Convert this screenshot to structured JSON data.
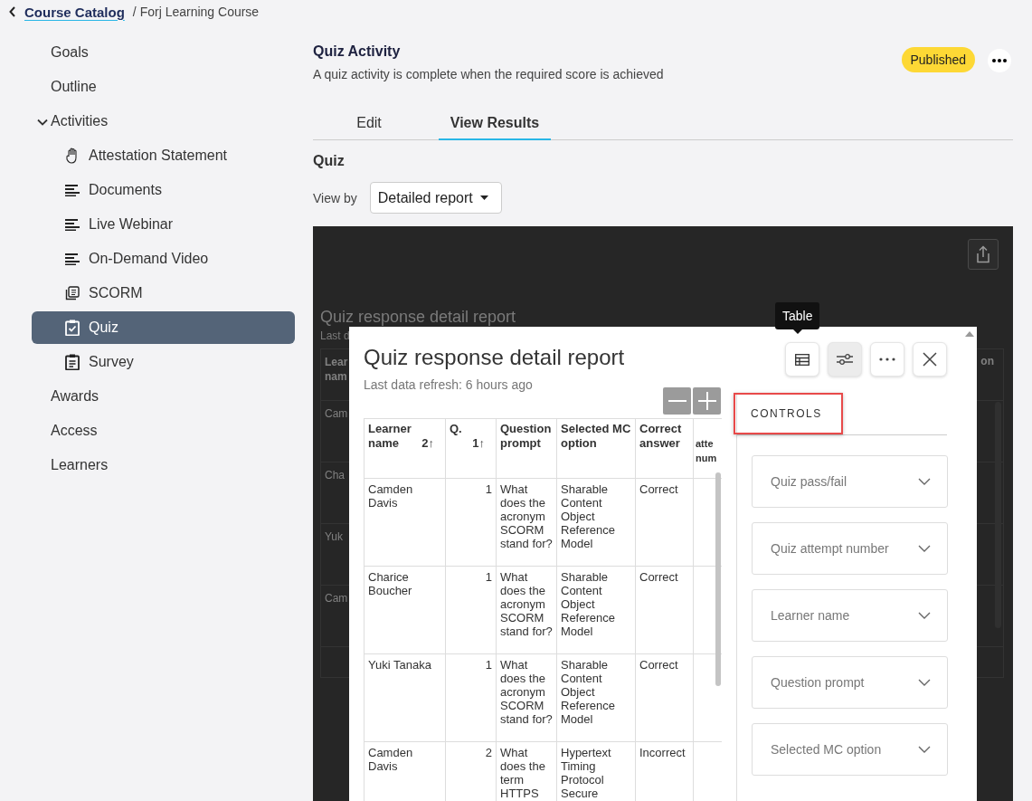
{
  "breadcrumb": {
    "link": "Course Catalog",
    "current": "/ Forj Learning Course"
  },
  "sidebar": {
    "items": [
      {
        "label": "Goals",
        "selected": false
      },
      {
        "label": "Outline",
        "selected": false
      },
      {
        "label": "Activities",
        "selected": false,
        "expanded": true,
        "children": [
          {
            "label": "Attestation Statement",
            "kind": "hand",
            "selected": false
          },
          {
            "label": "Documents",
            "kind": "lines",
            "selected": false
          },
          {
            "label": "Live Webinar",
            "kind": "lines",
            "selected": false
          },
          {
            "label": "On-Demand Video",
            "kind": "lines",
            "selected": false
          },
          {
            "label": "SCORM",
            "kind": "pages",
            "selected": false
          },
          {
            "label": "Quiz",
            "kind": "clipboard-check",
            "selected": true
          },
          {
            "label": "Survey",
            "kind": "clipboard",
            "selected": false
          }
        ]
      },
      {
        "label": "Awards",
        "selected": false
      },
      {
        "label": "Access",
        "selected": false
      },
      {
        "label": "Learners",
        "selected": false
      }
    ]
  },
  "activity": {
    "title": "Quiz Activity",
    "description": "A quiz activity is complete when the required score is achieved",
    "status": "Published"
  },
  "tabs": [
    {
      "label": "Edit",
      "selected": false
    },
    {
      "label": "View Results",
      "selected": true
    }
  ],
  "section_title": "Quiz",
  "view_by": {
    "label": "View by",
    "value": "Detailed report"
  },
  "background_report": {
    "title": "Quiz response detail report",
    "subtitle": "Last d",
    "header_fragment": "Lear nam",
    "row_fragments": [
      "Cam",
      "Cha",
      "Yuk",
      "Cam"
    ],
    "right_header_fragment": "on"
  },
  "report": {
    "title": "Quiz response detail report",
    "refresh": "Last data refresh: 6 hours ago",
    "tooltip": "Table",
    "toolbar": [
      {
        "kind": "table",
        "selected": false
      },
      {
        "kind": "controls",
        "selected": true
      },
      {
        "kind": "more",
        "selected": false
      },
      {
        "kind": "close",
        "selected": false
      }
    ],
    "table": {
      "columns": [
        {
          "label": "Learner name",
          "sort": "2↑"
        },
        {
          "label": "Q.",
          "sort": "1↑"
        },
        {
          "label": "Question prompt"
        },
        {
          "label": "Selected MC option"
        },
        {
          "label": "Correct answer"
        },
        {
          "label": "atte num"
        }
      ],
      "rows": [
        {
          "learner": "Camden Davis",
          "q": "1",
          "prompt": "What does the acronym SCORM stand for?",
          "option": "Sharable Content Object Reference Model",
          "correct": "Correct"
        },
        {
          "learner": "Charice Boucher",
          "q": "1",
          "prompt": "What does the acronym SCORM stand for?",
          "option": "Sharable Content Object Reference Model",
          "correct": "Correct"
        },
        {
          "learner": "Yuki Tanaka",
          "q": "1",
          "prompt": "What does the acronym SCORM stand for?",
          "option": "Sharable Content Object Reference Model",
          "correct": "Correct"
        },
        {
          "learner": "Camden Davis",
          "q": "2",
          "prompt": "What does the term HTTPS",
          "option": "Hypertext Timing Protocol Secure",
          "correct": "Incorrect"
        }
      ]
    },
    "controls": {
      "tab": "CONTROLS",
      "highlighted": true,
      "filters": [
        "Quiz pass/fail",
        "Quiz attempt number",
        "Learner name",
        "Question prompt",
        "Selected MC option"
      ]
    }
  }
}
